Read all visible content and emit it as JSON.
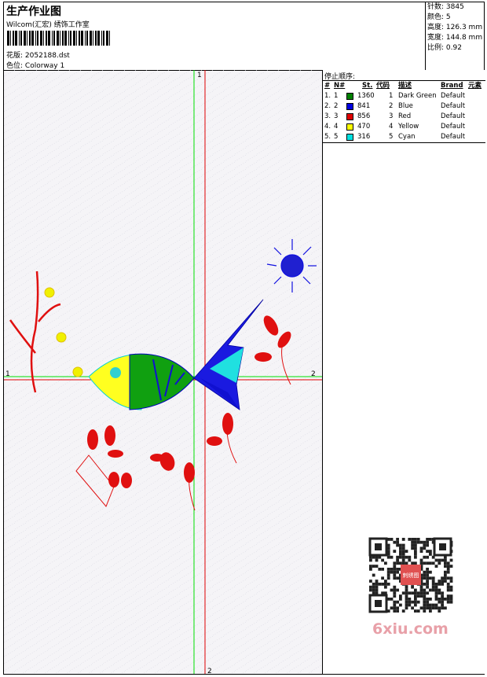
{
  "header": {
    "title": "生产作业图",
    "company": "Wilcom(汇宏) 绣饰工作室",
    "design_label": "花版:",
    "design_value": "2052188.dst",
    "colorway_label": "色位:",
    "colorway_value": "Colorway 1"
  },
  "stats": [
    {
      "label": "针数:",
      "value": "3845"
    },
    {
      "label": "颜色:",
      "value": "5"
    },
    {
      "label": "高度:",
      "value": "126.3 mm"
    },
    {
      "label": "宽度:",
      "value": "144.8 mm"
    },
    {
      "label": "比例:",
      "value": "0.92"
    }
  ],
  "stop_sequence": {
    "title": "停止顺序:",
    "columns": [
      "#",
      "N#",
      "St.",
      "代码",
      "描述",
      "Brand",
      "元素"
    ],
    "rows": [
      {
        "num": "1.",
        "n": "1",
        "color": "#008000",
        "stitches": "1360",
        "code": "1",
        "desc": "Dark Green",
        "brand": "Default"
      },
      {
        "num": "2.",
        "n": "2",
        "color": "#0000e0",
        "stitches": "841",
        "code": "2",
        "desc": "Blue",
        "brand": "Default"
      },
      {
        "num": "3.",
        "n": "3",
        "color": "#e00000",
        "stitches": "856",
        "code": "3",
        "desc": "Red",
        "brand": "Default"
      },
      {
        "num": "4.",
        "n": "4",
        "color": "#ffff00",
        "stitches": "470",
        "code": "4",
        "desc": "Yellow",
        "brand": "Default"
      },
      {
        "num": "5.",
        "n": "5",
        "color": "#00e0e0",
        "stitches": "316",
        "code": "5",
        "desc": "Cyan",
        "brand": "Default"
      }
    ]
  },
  "guides": {
    "v_top": "1",
    "v_bottom": "2",
    "h_left": "1",
    "h_right": "2"
  },
  "watermark": "6xiu.com",
  "qr_center": "刺绣图"
}
